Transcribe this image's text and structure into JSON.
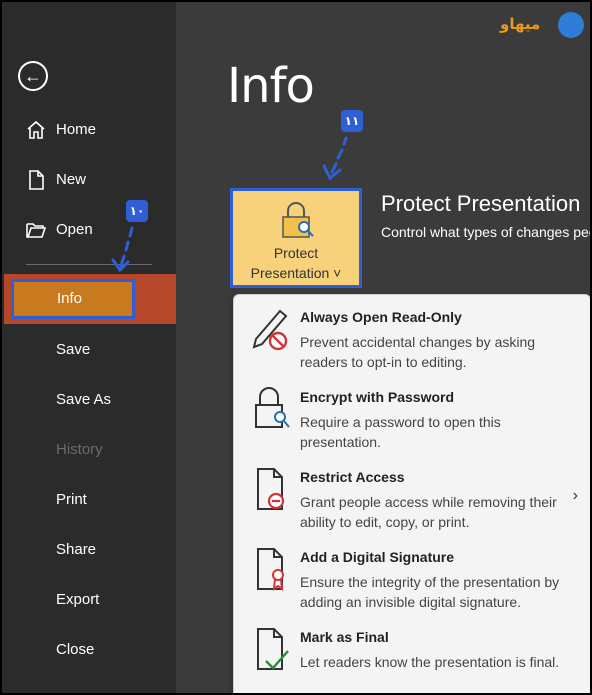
{
  "sidebar": {
    "back_icon": "arrow-left-circle-icon",
    "items": [
      {
        "label": "Home",
        "icon": "home-icon"
      },
      {
        "label": "New",
        "icon": "new-document-icon"
      },
      {
        "label": "Open",
        "icon": "open-folder-icon"
      },
      {
        "label": "Info"
      },
      {
        "label": "Save"
      },
      {
        "label": "Save As"
      },
      {
        "label": "History"
      },
      {
        "label": "Print"
      },
      {
        "label": "Share"
      },
      {
        "label": "Export"
      },
      {
        "label": "Close"
      }
    ]
  },
  "main": {
    "title": "Info",
    "protect_button": {
      "line1": "Protect",
      "line2": "Presentation ˅",
      "icon": "lock-key-icon"
    },
    "section_title": "Protect Presentation",
    "section_desc": "Control what types of changes people can make to this presentation."
  },
  "dropdown": {
    "items": [
      {
        "title": "Always Open Read-Only",
        "desc": "Prevent accidental changes by asking readers to opt-in to editing.",
        "icon": "pencil-prohibited-icon"
      },
      {
        "title": "Encrypt with Password",
        "desc": "Require a password to open this presentation.",
        "icon": "lock-key-icon"
      },
      {
        "title": "Restrict Access",
        "desc": "Grant people access while removing their ability to edit, copy, or print.",
        "icon": "document-restrict-icon"
      },
      {
        "title": "Add a Digital Signature",
        "desc": "Ensure the integrity of the presentation by adding an invisible digital signature.",
        "icon": "document-ribbon-icon"
      },
      {
        "title": "Mark as Final",
        "desc": "Let readers know the presentation is final.",
        "icon": "document-check-icon"
      }
    ],
    "submenu_icon": "chevron-right-icon"
  },
  "annotations": {
    "badge_10": "۱۰",
    "badge_11": "۱۱",
    "logo_text": "میهاو"
  },
  "colors": {
    "sidebar_bg": "#2b2b2b",
    "main_bg": "#3b3b3b",
    "info_selected": "#b7472a",
    "annotation_blue": "#2f5fd6",
    "protect_button_bg": "#f7d27b"
  }
}
